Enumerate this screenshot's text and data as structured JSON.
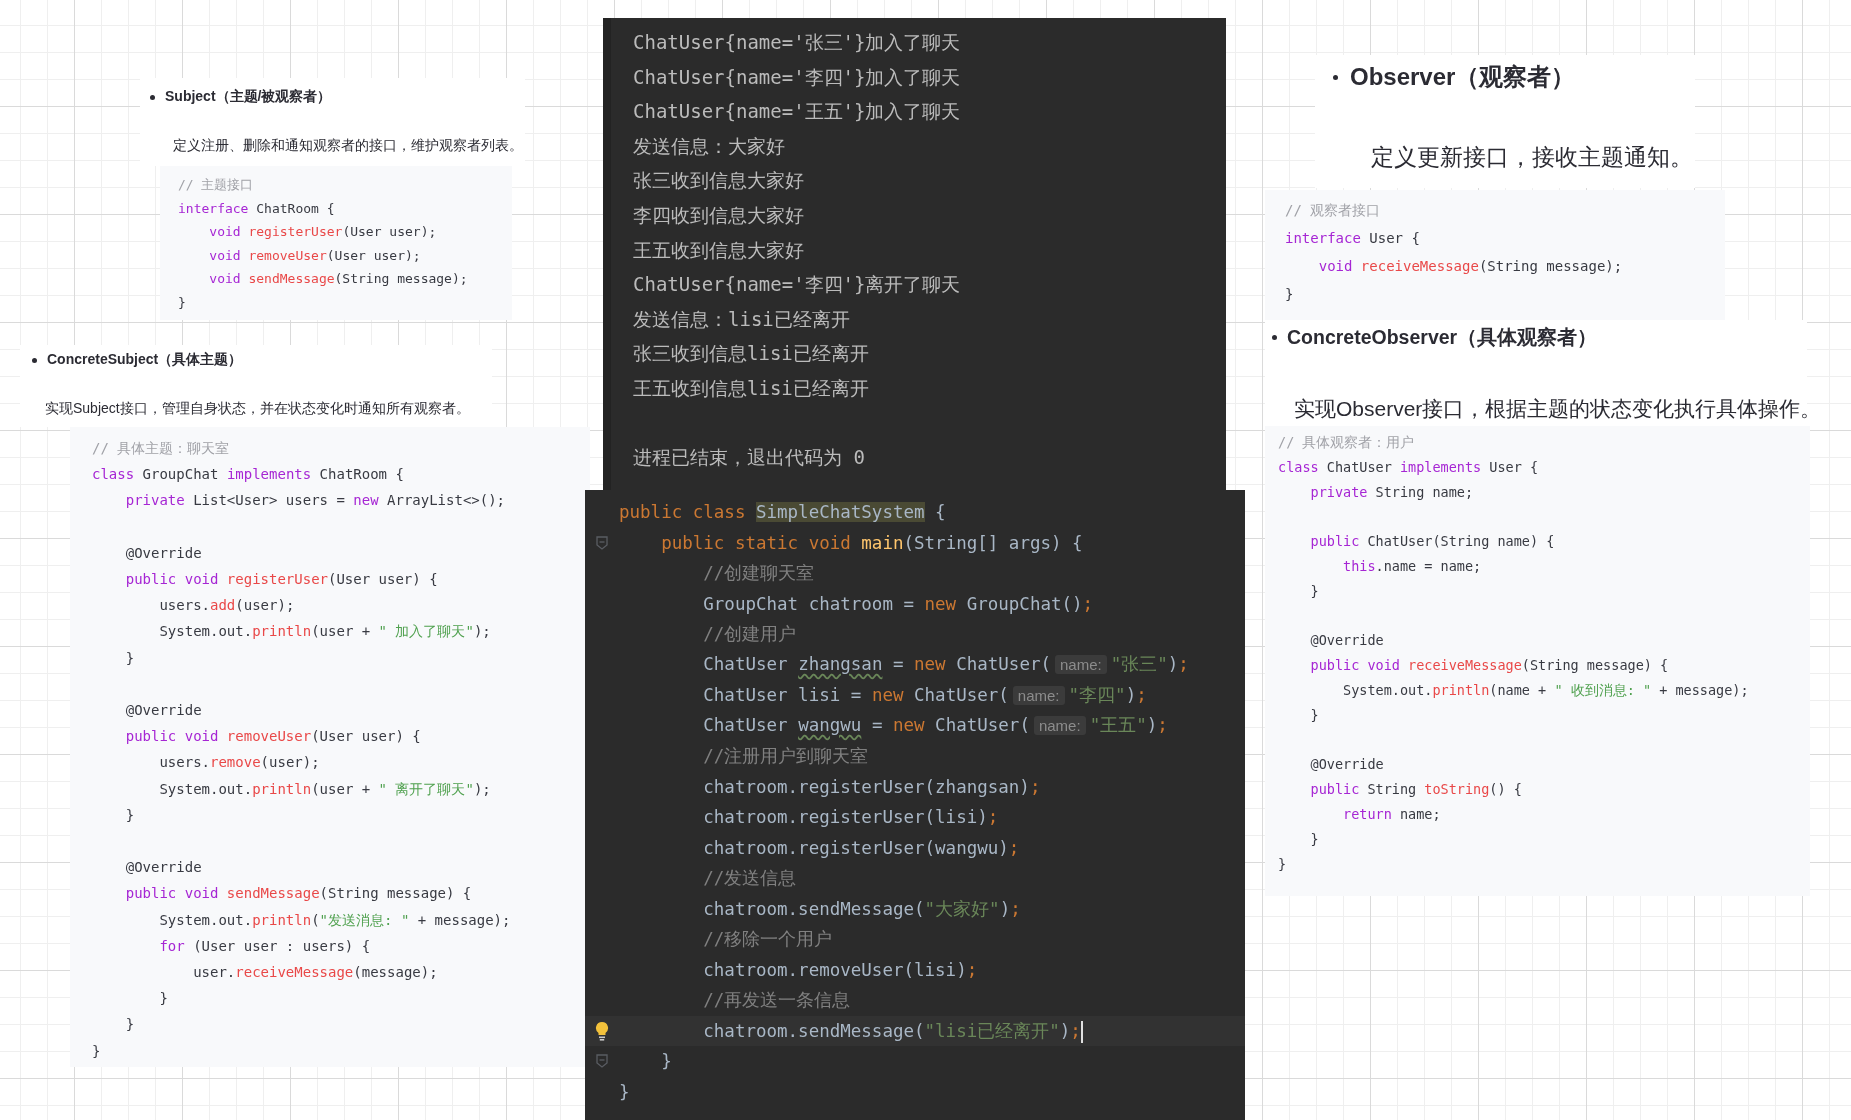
{
  "subject": {
    "title": "Subject（主题/被观察者）",
    "description": "定义注册、删除和通知观察者的接口，维护观察者列表。",
    "code": [
      {
        "tokens": [
          {
            "kind": "comment",
            "text": "// 主题接口"
          }
        ]
      },
      {
        "tokens": [
          {
            "kind": "keyword",
            "text": "interface"
          },
          {
            "kind": "plain",
            "text": " ChatRoom {"
          }
        ]
      },
      {
        "tokens": [
          {
            "kind": "keyword",
            "text": "    void "
          },
          {
            "kind": "function",
            "text": "registerUser"
          },
          {
            "kind": "plain",
            "text": "(User user);"
          }
        ]
      },
      {
        "tokens": [
          {
            "kind": "keyword",
            "text": "    void "
          },
          {
            "kind": "function",
            "text": "removeUser"
          },
          {
            "kind": "plain",
            "text": "(User user);"
          }
        ]
      },
      {
        "tokens": [
          {
            "kind": "keyword",
            "text": "    void "
          },
          {
            "kind": "function",
            "text": "sendMessage"
          },
          {
            "kind": "plain",
            "text": "(String message);"
          }
        ]
      },
      {
        "tokens": [
          {
            "kind": "plain",
            "text": "}"
          }
        ]
      }
    ]
  },
  "concrete_subject": {
    "title": "ConcreteSubject（具体主题）",
    "description": "实现Subject接口，管理自身状态，并在状态变化时通知所有观察者。",
    "code": [
      {
        "tokens": [
          {
            "kind": "comment",
            "text": "// 具体主题：聊天室"
          }
        ]
      },
      {
        "tokens": [
          {
            "kind": "keyword",
            "text": "class"
          },
          {
            "kind": "plain",
            "text": " GroupChat "
          },
          {
            "kind": "keyword",
            "text": "implements"
          },
          {
            "kind": "plain",
            "text": " ChatRoom {"
          }
        ]
      },
      {
        "tokens": [
          {
            "kind": "keyword",
            "text": "    private"
          },
          {
            "kind": "plain",
            "text": " List<User> users = "
          },
          {
            "kind": "keyword",
            "text": "new"
          },
          {
            "kind": "plain",
            "text": " ArrayList<>();"
          }
        ]
      },
      {
        "gap_before": true,
        "tokens": [
          {
            "kind": "plain",
            "text": "    @Override"
          }
        ]
      },
      {
        "tokens": [
          {
            "kind": "keyword",
            "text": "    public void "
          },
          {
            "kind": "function",
            "text": "registerUser"
          },
          {
            "kind": "plain",
            "text": "(User user) {"
          }
        ]
      },
      {
        "tokens": [
          {
            "kind": "plain",
            "text": "        users."
          },
          {
            "kind": "function",
            "text": "add"
          },
          {
            "kind": "plain",
            "text": "(user);"
          }
        ]
      },
      {
        "tokens": [
          {
            "kind": "plain",
            "text": "        System.out."
          },
          {
            "kind": "function",
            "text": "println"
          },
          {
            "kind": "plain",
            "text": "(user + "
          },
          {
            "kind": "string",
            "text": "\" 加入了聊天\""
          },
          {
            "kind": "plain",
            "text": ");"
          }
        ]
      },
      {
        "tokens": [
          {
            "kind": "plain",
            "text": "    }"
          }
        ]
      },
      {
        "gap_before": true,
        "tokens": [
          {
            "kind": "plain",
            "text": "    @Override"
          }
        ]
      },
      {
        "tokens": [
          {
            "kind": "keyword",
            "text": "    public void "
          },
          {
            "kind": "function",
            "text": "removeUser"
          },
          {
            "kind": "plain",
            "text": "(User user) {"
          }
        ]
      },
      {
        "tokens": [
          {
            "kind": "plain",
            "text": "        users."
          },
          {
            "kind": "function",
            "text": "remove"
          },
          {
            "kind": "plain",
            "text": "(user);"
          }
        ]
      },
      {
        "tokens": [
          {
            "kind": "plain",
            "text": "        System.out."
          },
          {
            "kind": "function",
            "text": "println"
          },
          {
            "kind": "plain",
            "text": "(user + "
          },
          {
            "kind": "string",
            "text": "\" 离开了聊天\""
          },
          {
            "kind": "plain",
            "text": ");"
          }
        ]
      },
      {
        "tokens": [
          {
            "kind": "plain",
            "text": "    }"
          }
        ]
      },
      {
        "gap_before": true,
        "tokens": [
          {
            "kind": "plain",
            "text": "    @Override"
          }
        ]
      },
      {
        "tokens": [
          {
            "kind": "keyword",
            "text": "    public void "
          },
          {
            "kind": "function",
            "text": "sendMessage"
          },
          {
            "kind": "plain",
            "text": "(String message) {"
          }
        ]
      },
      {
        "tokens": [
          {
            "kind": "plain",
            "text": "        System.out."
          },
          {
            "kind": "function",
            "text": "println"
          },
          {
            "kind": "plain",
            "text": "("
          },
          {
            "kind": "string",
            "text": "\"发送消息: \""
          },
          {
            "kind": "plain",
            "text": " + message);"
          }
        ]
      },
      {
        "tokens": [
          {
            "kind": "keyword",
            "text": "        for"
          },
          {
            "kind": "plain",
            "text": " (User user : users) {"
          }
        ]
      },
      {
        "tokens": [
          {
            "kind": "plain",
            "text": "            user."
          },
          {
            "kind": "function",
            "text": "receiveMessage"
          },
          {
            "kind": "plain",
            "text": "(message);"
          }
        ]
      },
      {
        "tokens": [
          {
            "kind": "plain",
            "text": "        }"
          }
        ]
      },
      {
        "tokens": [
          {
            "kind": "plain",
            "text": "    }"
          }
        ]
      },
      {
        "tokens": [
          {
            "kind": "plain",
            "text": "}"
          }
        ]
      }
    ]
  },
  "console": {
    "lines": [
      "ChatUser{name='张三'}加入了聊天",
      "ChatUser{name='李四'}加入了聊天",
      "ChatUser{name='王五'}加入了聊天",
      "发送信息：大家好",
      "张三收到信息大家好",
      "李四收到信息大家好",
      "王五收到信息大家好",
      "ChatUser{name='李四'}离开了聊天",
      "发送信息：lisi已经离开",
      "张三收到信息lisi已经离开",
      "王五收到信息lisi已经离开"
    ],
    "exit_message": "进程已结束，退出代码为 0"
  },
  "editor": {
    "lines": [
      {
        "tokens": [
          {
            "kind": "keyword",
            "text": "public class "
          },
          {
            "kind": "highlight",
            "text": "SimpleChatSystem"
          },
          {
            "kind": "plain",
            "text": " {"
          }
        ]
      },
      {
        "fold_marker": true,
        "tokens": [
          {
            "kind": "keyword",
            "text": "    public static void "
          },
          {
            "kind": "function",
            "text": "main"
          },
          {
            "kind": "plain",
            "text": "(String[] args) {"
          }
        ]
      },
      {
        "tokens": [
          {
            "kind": "comment",
            "text": "        //创建聊天室"
          }
        ]
      },
      {
        "tokens": [
          {
            "kind": "plain",
            "text": "        GroupChat chatroom = "
          },
          {
            "kind": "keyword",
            "text": "new"
          },
          {
            "kind": "plain",
            "text": " GroupChat()"
          },
          {
            "kind": "keyword",
            "text": ";"
          }
        ]
      },
      {
        "tokens": [
          {
            "kind": "comment",
            "text": "        //创建用户"
          }
        ]
      },
      {
        "tokens": [
          {
            "kind": "plain",
            "text": "        ChatUser "
          },
          {
            "kind": "warning",
            "text": "zhangsan"
          },
          {
            "kind": "plain",
            "text": " = "
          },
          {
            "kind": "keyword",
            "text": "new"
          },
          {
            "kind": "plain",
            "text": " ChatUser("
          },
          {
            "kind": "hint",
            "text": "name:"
          },
          {
            "kind": "string",
            "text": "\"张三\""
          },
          {
            "kind": "plain",
            "text": ")"
          },
          {
            "kind": "keyword",
            "text": ";"
          }
        ]
      },
      {
        "tokens": [
          {
            "kind": "plain",
            "text": "        ChatUser lisi = "
          },
          {
            "kind": "keyword",
            "text": "new"
          },
          {
            "kind": "plain",
            "text": " ChatUser("
          },
          {
            "kind": "hint",
            "text": "name:"
          },
          {
            "kind": "string",
            "text": "\"李四\""
          },
          {
            "kind": "plain",
            "text": ")"
          },
          {
            "kind": "keyword",
            "text": ";"
          }
        ]
      },
      {
        "tokens": [
          {
            "kind": "plain",
            "text": "        ChatUser "
          },
          {
            "kind": "warning",
            "text": "wangwu"
          },
          {
            "kind": "plain",
            "text": " = "
          },
          {
            "kind": "keyword",
            "text": "new"
          },
          {
            "kind": "plain",
            "text": " ChatUser("
          },
          {
            "kind": "hint",
            "text": "name:"
          },
          {
            "kind": "string",
            "text": "\"王五\""
          },
          {
            "kind": "plain",
            "text": ")"
          },
          {
            "kind": "keyword",
            "text": ";"
          }
        ]
      },
      {
        "tokens": [
          {
            "kind": "comment",
            "text": "        //注册用户到聊天室"
          }
        ]
      },
      {
        "tokens": [
          {
            "kind": "plain",
            "text": "        chatroom.registerUser(zhangsan)"
          },
          {
            "kind": "keyword",
            "text": ";"
          }
        ]
      },
      {
        "tokens": [
          {
            "kind": "plain",
            "text": "        chatroom.registerUser(lisi)"
          },
          {
            "kind": "keyword",
            "text": ";"
          }
        ]
      },
      {
        "tokens": [
          {
            "kind": "plain",
            "text": "        chatroom.registerUser(wangwu)"
          },
          {
            "kind": "keyword",
            "text": ";"
          }
        ]
      },
      {
        "tokens": [
          {
            "kind": "comment",
            "text": "        //发送信息"
          }
        ]
      },
      {
        "tokens": [
          {
            "kind": "plain",
            "text": "        chatroom.sendMessage("
          },
          {
            "kind": "string",
            "text": "\"大家好\""
          },
          {
            "kind": "plain",
            "text": ")"
          },
          {
            "kind": "keyword",
            "text": ";"
          }
        ]
      },
      {
        "tokens": [
          {
            "kind": "comment",
            "text": "        //移除一个用户"
          }
        ]
      },
      {
        "tokens": [
          {
            "kind": "plain",
            "text": "        chatroom.removeUser(lisi)"
          },
          {
            "kind": "keyword",
            "text": ";"
          }
        ]
      },
      {
        "tokens": [
          {
            "kind": "comment",
            "text": "        //再发送一条信息"
          }
        ]
      },
      {
        "current": true,
        "bulb": true,
        "tokens": [
          {
            "kind": "plain",
            "text": "        chatroom.sendMessage("
          },
          {
            "kind": "string",
            "text": "\"lisi已经离开\""
          },
          {
            "kind": "plain",
            "text": ")"
          },
          {
            "kind": "keyword",
            "text": ";"
          }
        ]
      },
      {
        "fold_marker": true,
        "tokens": [
          {
            "kind": "plain",
            "text": "    }"
          }
        ]
      },
      {
        "tokens": [
          {
            "kind": "plain",
            "text": "}"
          }
        ]
      }
    ]
  },
  "observer": {
    "title": "Observer（观察者）",
    "description": "定义更新接口，接收主题通知。",
    "code": [
      {
        "tokens": [
          {
            "kind": "comment",
            "text": "// 观察者接口"
          }
        ]
      },
      {
        "tokens": [
          {
            "kind": "keyword",
            "text": "interface"
          },
          {
            "kind": "plain",
            "text": " User {"
          }
        ]
      },
      {
        "tokens": [
          {
            "kind": "keyword",
            "text": "    void "
          },
          {
            "kind": "function",
            "text": "receiveMessage"
          },
          {
            "kind": "plain",
            "text": "(String message);"
          }
        ]
      },
      {
        "tokens": [
          {
            "kind": "plain",
            "text": "}"
          }
        ]
      }
    ]
  },
  "concrete_observer": {
    "title": "ConcreteObserver（具体观察者）",
    "description": "实现Observer接口，根据主题的状态变化执行具体操作。",
    "code": [
      {
        "tokens": [
          {
            "kind": "comment",
            "text": "// 具体观察者：用户"
          }
        ]
      },
      {
        "tokens": [
          {
            "kind": "keyword",
            "text": "class"
          },
          {
            "kind": "plain",
            "text": " ChatUser "
          },
          {
            "kind": "keyword",
            "text": "implements"
          },
          {
            "kind": "plain",
            "text": " User {"
          }
        ]
      },
      {
        "tokens": [
          {
            "kind": "keyword",
            "text": "    private"
          },
          {
            "kind": "plain",
            "text": " String name;"
          }
        ]
      },
      {
        "gap_before": true,
        "tokens": [
          {
            "kind": "keyword",
            "text": "    public"
          },
          {
            "kind": "plain",
            "text": " ChatUser(String name) {"
          }
        ]
      },
      {
        "tokens": [
          {
            "kind": "keyword",
            "text": "        this"
          },
          {
            "kind": "plain",
            "text": ".name = name;"
          }
        ]
      },
      {
        "tokens": [
          {
            "kind": "plain",
            "text": "    }"
          }
        ]
      },
      {
        "gap_before": true,
        "tokens": [
          {
            "kind": "plain",
            "text": "    @Override"
          }
        ]
      },
      {
        "tokens": [
          {
            "kind": "keyword",
            "text": "    public void "
          },
          {
            "kind": "function",
            "text": "receiveMessage"
          },
          {
            "kind": "plain",
            "text": "(String message) {"
          }
        ]
      },
      {
        "tokens": [
          {
            "kind": "plain",
            "text": "        System.out."
          },
          {
            "kind": "function",
            "text": "println"
          },
          {
            "kind": "plain",
            "text": "(name + "
          },
          {
            "kind": "string",
            "text": "\" 收到消息: \""
          },
          {
            "kind": "plain",
            "text": " + message);"
          }
        ]
      },
      {
        "tokens": [
          {
            "kind": "plain",
            "text": "    }"
          }
        ]
      },
      {
        "gap_before": true,
        "tokens": [
          {
            "kind": "plain",
            "text": "    @Override"
          }
        ]
      },
      {
        "tokens": [
          {
            "kind": "keyword",
            "text": "    public"
          },
          {
            "kind": "plain",
            "text": " String "
          },
          {
            "kind": "function",
            "text": "toString"
          },
          {
            "kind": "plain",
            "text": "() {"
          }
        ]
      },
      {
        "tokens": [
          {
            "kind": "keyword",
            "text": "        return"
          },
          {
            "kind": "plain",
            "text": " name;"
          }
        ]
      },
      {
        "tokens": [
          {
            "kind": "plain",
            "text": "    }"
          }
        ]
      },
      {
        "tokens": [
          {
            "kind": "plain",
            "text": "}"
          }
        ]
      }
    ]
  }
}
